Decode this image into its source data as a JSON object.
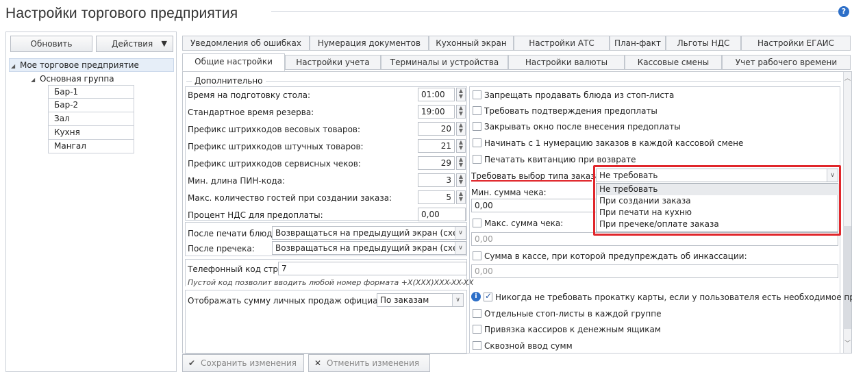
{
  "page": {
    "title": "Настройки торгового предприятия"
  },
  "left": {
    "refresh_label": "Обновить",
    "actions_label": "Действия",
    "tree": {
      "root": "Мое торговое предприятие",
      "group": "Основная группа",
      "items": [
        "Бар-1",
        "Бар-2",
        "Зал",
        "Кухня",
        "Мангал"
      ]
    }
  },
  "tabs": {
    "row1": [
      "Уведомления об ошибках",
      "Нумерация документов",
      "Кухонный экран",
      "Настройки АТС",
      "План-факт",
      "Льготы НДС",
      "Настройки ЕГАИС"
    ],
    "row2": [
      "Общие настройки",
      "Настройки учета",
      "Терминалы и устройства",
      "Настройки валюты",
      "Кассовые смены",
      "Учет рабочего времени"
    ],
    "active": "Общие настройки"
  },
  "section": {
    "title": "Дополнительно"
  },
  "fields": [
    {
      "label": "Время на подготовку стола:",
      "value": "01:00"
    },
    {
      "label": "Стандартное время резерва:",
      "value": "19:00"
    },
    {
      "label": "Префикс штрихкодов весовых товаров:",
      "value": "20"
    },
    {
      "label": "Префикс штрихкодов штучных товаров:",
      "value": "21"
    },
    {
      "label": "Префикс штрихкодов сервисных чеков:",
      "value": "29"
    },
    {
      "label": "Мин. длина ПИН-кода:",
      "value": "3"
    },
    {
      "label": "Макс. количество гостей при создании заказа:",
      "value": "5"
    },
    {
      "label": "Процент НДС для предоплаты:",
      "value": "0,00"
    }
  ],
  "after_print": {
    "label": "После печати блюд:",
    "value": "Возвращаться на предыдущий экран (схем..."
  },
  "after_precheck": {
    "label": "После пречека:",
    "value": "Возвращаться на предыдущий экран (схем..."
  },
  "phone": {
    "label": "Телефонный код страны: +",
    "value": "7",
    "hint": "Пустой код позволит вводить любой номер формата +X(XXX)XXX-XX-XX"
  },
  "waiter_sales": {
    "label": "Отображать сумму личных продаж официанта:",
    "value": "По заказам"
  },
  "checks": [
    {
      "label": "Запрещать продавать блюда из стоп-листа",
      "checked": false
    },
    {
      "label": "Требовать подтверждения предоплаты",
      "checked": false
    },
    {
      "label": "Закрывать окно после внесения предоплаты",
      "checked": false
    },
    {
      "label": "Начинать с 1 нумерацию заказов в каждой кассовой смене",
      "checked": false
    },
    {
      "label": "Печатать квитанцию при возврате",
      "checked": false
    }
  ],
  "order_type": {
    "label": "Требовать выбор типа заказа:",
    "value": "Не требовать",
    "options": [
      "Не требовать",
      "При создании заказа",
      "При печати на кухню",
      "При пречеке/оплате заказа"
    ]
  },
  "min_sum": {
    "label": "Мин. сумма чека:",
    "value": "0,00"
  },
  "max_sum": {
    "label": "Макс. сумма чека:",
    "value": "0,00"
  },
  "cash_sum": {
    "label": "Сумма в кассе, при которой предупреждать об инкассации:",
    "value": "0,00"
  },
  "checks2": [
    {
      "label": "Никогда не требовать прокатку карты, если у пользователя есть необходимое право",
      "checked": true
    },
    {
      "label": "Отдельные стоп-листы в каждой группе",
      "checked": false
    },
    {
      "label": "Привязка кассиров к денежным ящикам",
      "checked": false
    },
    {
      "label": "Сквозной ввод сумм",
      "checked": false
    }
  ],
  "bottom": {
    "save_label": "Сохранить изменения",
    "cancel_label": "Отменить изменения"
  },
  "colors": {
    "highlight": "#e0262b",
    "accent": "#2d6fc8"
  }
}
